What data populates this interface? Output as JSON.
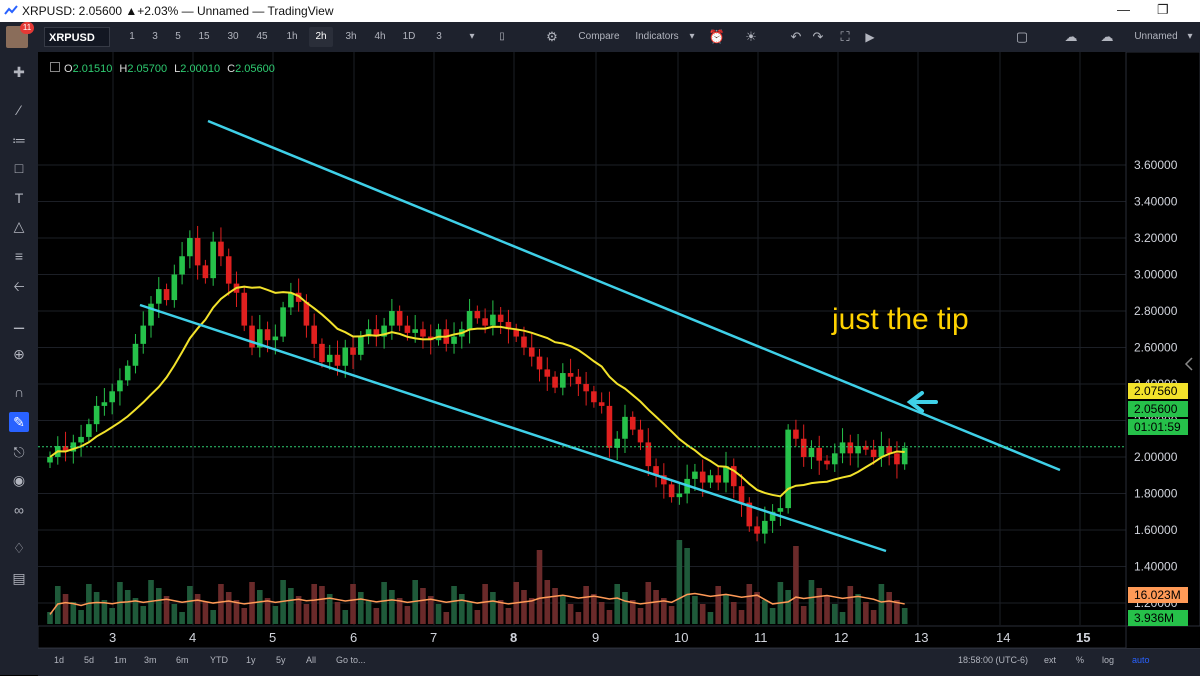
{
  "window": {
    "title": "XRPUSD: 2.05600 ▲+2.03% — Unnamed — TradingView"
  },
  "toolbar": {
    "badge": "11",
    "symbol": "XRPUSD",
    "intervals": [
      "1",
      "3",
      "5",
      "15",
      "30",
      "45",
      "1h",
      "2h",
      "3h",
      "4h",
      "1D",
      "3"
    ],
    "active_interval": "2h",
    "compare": "Compare",
    "indicators": "Indicators",
    "layout": "Unnamed"
  },
  "legend": {
    "o_label": "O",
    "o": "2.01510",
    "h_label": "H",
    "h": "2.05700",
    "l_label": "L",
    "l": "2.00010",
    "c_label": "C",
    "c": "2.05600"
  },
  "price_axis": {
    "ticks": [
      "3.60000",
      "3.40000",
      "3.20000",
      "3.00000",
      "2.80000",
      "2.60000",
      "2.40000",
      "2.20000",
      "2.00000",
      "1.80000",
      "1.60000",
      "1.40000",
      "1.20000"
    ],
    "labels": {
      "ma_value": "2.07560",
      "last_price": "2.05600",
      "countdown": "01:01:59",
      "vol_ma": "16.023M",
      "vol": "3.936M"
    }
  },
  "time_axis": [
    "3",
    "4",
    "5",
    "6",
    "7",
    "8",
    "9",
    "10",
    "11",
    "12",
    "13",
    "14",
    "15"
  ],
  "bottombar": {
    "ranges": [
      "1d",
      "5d",
      "1m",
      "3m",
      "6m",
      "YTD",
      "1y",
      "5y",
      "All"
    ],
    "goto": "Go to...",
    "clock": "18:58:00 (UTC-6)",
    "ext": "ext",
    "pct": "%",
    "log": "log",
    "auto": "auto"
  },
  "annotation": "just the tip",
  "colors": {
    "up": "#26c14a",
    "down": "#e0201f",
    "channel": "#3fd0e8",
    "ma": "#f2e22b",
    "vol_ma": "#ff9a57"
  },
  "chart_data": {
    "type": "candlestick",
    "x_ticks": [
      "3",
      "4",
      "5",
      "6",
      "7",
      "8",
      "9",
      "10",
      "11",
      "12",
      "13",
      "14",
      "15"
    ],
    "ylim": [
      1.1,
      3.62
    ],
    "close": [
      2.0,
      2.06,
      2.03,
      2.08,
      2.11,
      2.18,
      2.28,
      2.3,
      2.36,
      2.42,
      2.5,
      2.62,
      2.72,
      2.84,
      2.92,
      2.86,
      3.0,
      3.1,
      3.2,
      3.05,
      2.98,
      3.18,
      3.1,
      2.95,
      2.9,
      2.72,
      2.6,
      2.7,
      2.64,
      2.66,
      2.82,
      2.9,
      2.85,
      2.72,
      2.62,
      2.52,
      2.56,
      2.5,
      2.6,
      2.56,
      2.66,
      2.7,
      2.66,
      2.72,
      2.8,
      2.72,
      2.68,
      2.7,
      2.66,
      2.64,
      2.7,
      2.62,
      2.66,
      2.7,
      2.8,
      2.76,
      2.72,
      2.78,
      2.74,
      2.7,
      2.66,
      2.6,
      2.55,
      2.48,
      2.44,
      2.38,
      2.46,
      2.44,
      2.4,
      2.36,
      2.3,
      2.28,
      2.05,
      2.1,
      2.22,
      2.15,
      2.08,
      1.95,
      1.9,
      1.85,
      1.78,
      1.8,
      1.88,
      1.92,
      1.86,
      1.9,
      1.86,
      1.95,
      1.84,
      1.75,
      1.62,
      1.58,
      1.65,
      1.7,
      1.72,
      2.15,
      2.1,
      2.0,
      2.05,
      1.98,
      1.96,
      2.02,
      2.08,
      2.02,
      2.06,
      2.04,
      2.0,
      2.06,
      2.02,
      1.96,
      2.05
    ],
    "volume_max_M": 40
  }
}
